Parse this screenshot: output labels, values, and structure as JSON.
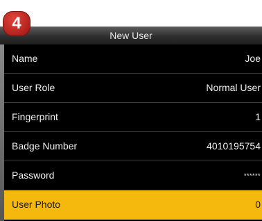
{
  "step_badge": "4",
  "window": {
    "title": "New User"
  },
  "fields": [
    {
      "label": "Name",
      "value": "Joe"
    },
    {
      "label": "User Role",
      "value": "Normal User"
    },
    {
      "label": "Fingerprint",
      "value": "1"
    },
    {
      "label": "Badge Number",
      "value": "4010195754"
    },
    {
      "label": "Password",
      "value": "******"
    },
    {
      "label": "User Photo",
      "value": "0"
    }
  ],
  "colors": {
    "selected_row": "#f5b90d",
    "background": "#000000",
    "badge": "#c62b24"
  }
}
